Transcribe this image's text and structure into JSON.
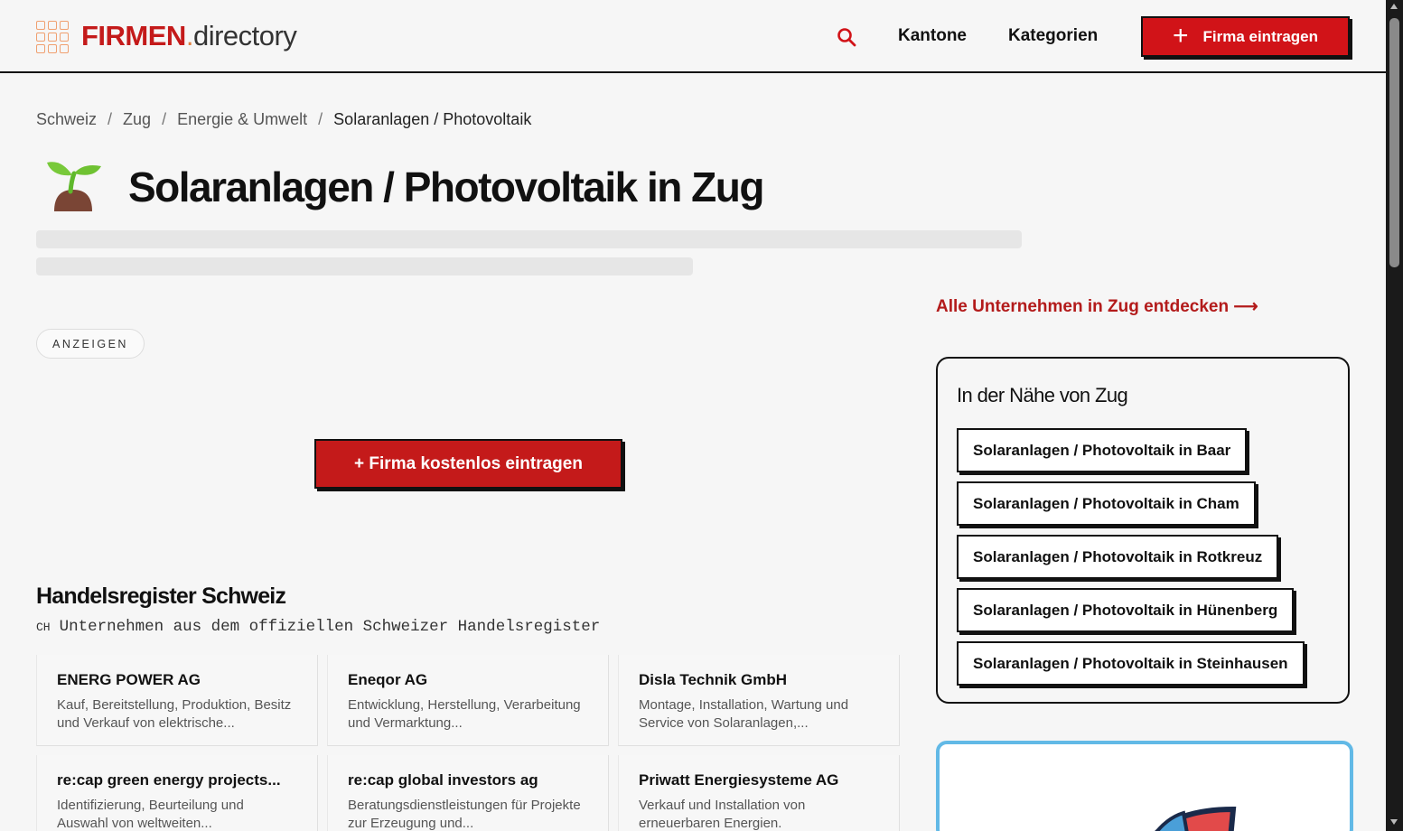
{
  "header": {
    "logo_primary": "FIRMEN",
    "logo_dot": ".",
    "logo_secondary": "directory",
    "nav": [
      "Kantone",
      "Kategorien"
    ],
    "cta_label": "Firma eintragen"
  },
  "breadcrumb": [
    "Schweiz",
    "Zug",
    "Energie & Umwelt",
    "Solaranlagen / Photovoltaik"
  ],
  "title": "Solaranlagen / Photovoltaik in Zug",
  "ads_label": "ANZEIGEN",
  "free_button": "+ Firma kostenlos eintragen",
  "register": {
    "title": "Handelsregister Schweiz",
    "flag": "CH",
    "subtitle": "Unternehmen aus dem offiziellen Schweizer Handelsregister",
    "companies": [
      {
        "name": "ENERG POWER AG",
        "desc": "Kauf, Bereitstellung, Produktion, Besitz und Verkauf von elektrische..."
      },
      {
        "name": "Eneqor AG",
        "desc": "Entwicklung, Herstellung, Verarbeitung und Vermarktung..."
      },
      {
        "name": "Disla Technik GmbH",
        "desc": "Montage, Installation, Wartung und Service von Solaranlagen,..."
      },
      {
        "name": "re:cap green energy projects...",
        "desc": "Identifizierung, Beurteilung und Auswahl von weltweiten..."
      },
      {
        "name": "re:cap global investors ag",
        "desc": "Beratungsdienstleistungen für Projekte zur Erzeugung und..."
      },
      {
        "name": "Priwatt Energiesysteme AG",
        "desc": "Verkauf und Installation von erneuerbaren Energien."
      }
    ]
  },
  "sidebar": {
    "discover_link": "Alle Unternehmen in Zug entdecken ⟶",
    "nearby_title": "In der Nähe von Zug",
    "nearby_links": [
      "Solaranlagen / Photovoltaik in Baar",
      "Solaranlagen / Photovoltaik in Cham",
      "Solaranlagen / Photovoltaik in Rotkreuz",
      "Solaranlagen / Photovoltaik in Hünenberg",
      "Solaranlagen / Photovoltaik in Steinhausen"
    ]
  },
  "colors": {
    "brand_red": "#d11318",
    "link_red": "#b31b1b",
    "card_border_blue": "#62b9e6"
  }
}
